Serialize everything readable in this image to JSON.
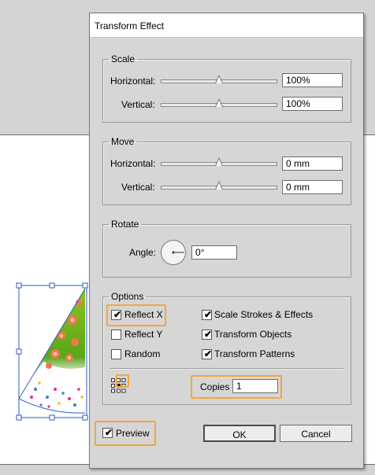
{
  "dialog": {
    "title": "Transform Effect"
  },
  "scale": {
    "legend": "Scale",
    "horizontal_label": "Horizontal:",
    "horizontal_value": "100%",
    "vertical_label": "Vertical:",
    "vertical_value": "100%"
  },
  "move": {
    "legend": "Move",
    "horizontal_label": "Horizontal:",
    "horizontal_value": "0 mm",
    "vertical_label": "Vertical:",
    "vertical_value": "0 mm"
  },
  "rotate": {
    "legend": "Rotate",
    "angle_label": "Angle:",
    "angle_value": "0°"
  },
  "options": {
    "legend": "Options",
    "reflect_x": {
      "label": "Reflect X",
      "checked": true
    },
    "reflect_y": {
      "label": "Reflect Y",
      "checked": false
    },
    "random": {
      "label": "Random",
      "checked": false
    },
    "scale_strokes": {
      "label": "Scale Strokes & Effects",
      "checked": true
    },
    "transform_objects": {
      "label": "Transform Objects",
      "checked": true
    },
    "transform_patterns": {
      "label": "Transform Patterns",
      "checked": true
    },
    "copies_label": "Copies",
    "copies_value": "1"
  },
  "preview": {
    "label": "Preview",
    "checked": true
  },
  "buttons": {
    "ok": "OK",
    "cancel": "Cancel"
  },
  "colors": {
    "highlight": "#f4a63c",
    "dialog_bg": "#d6d6d6"
  },
  "icons": {
    "reference_point": "reference-point-icon",
    "checkmark": "✔"
  }
}
